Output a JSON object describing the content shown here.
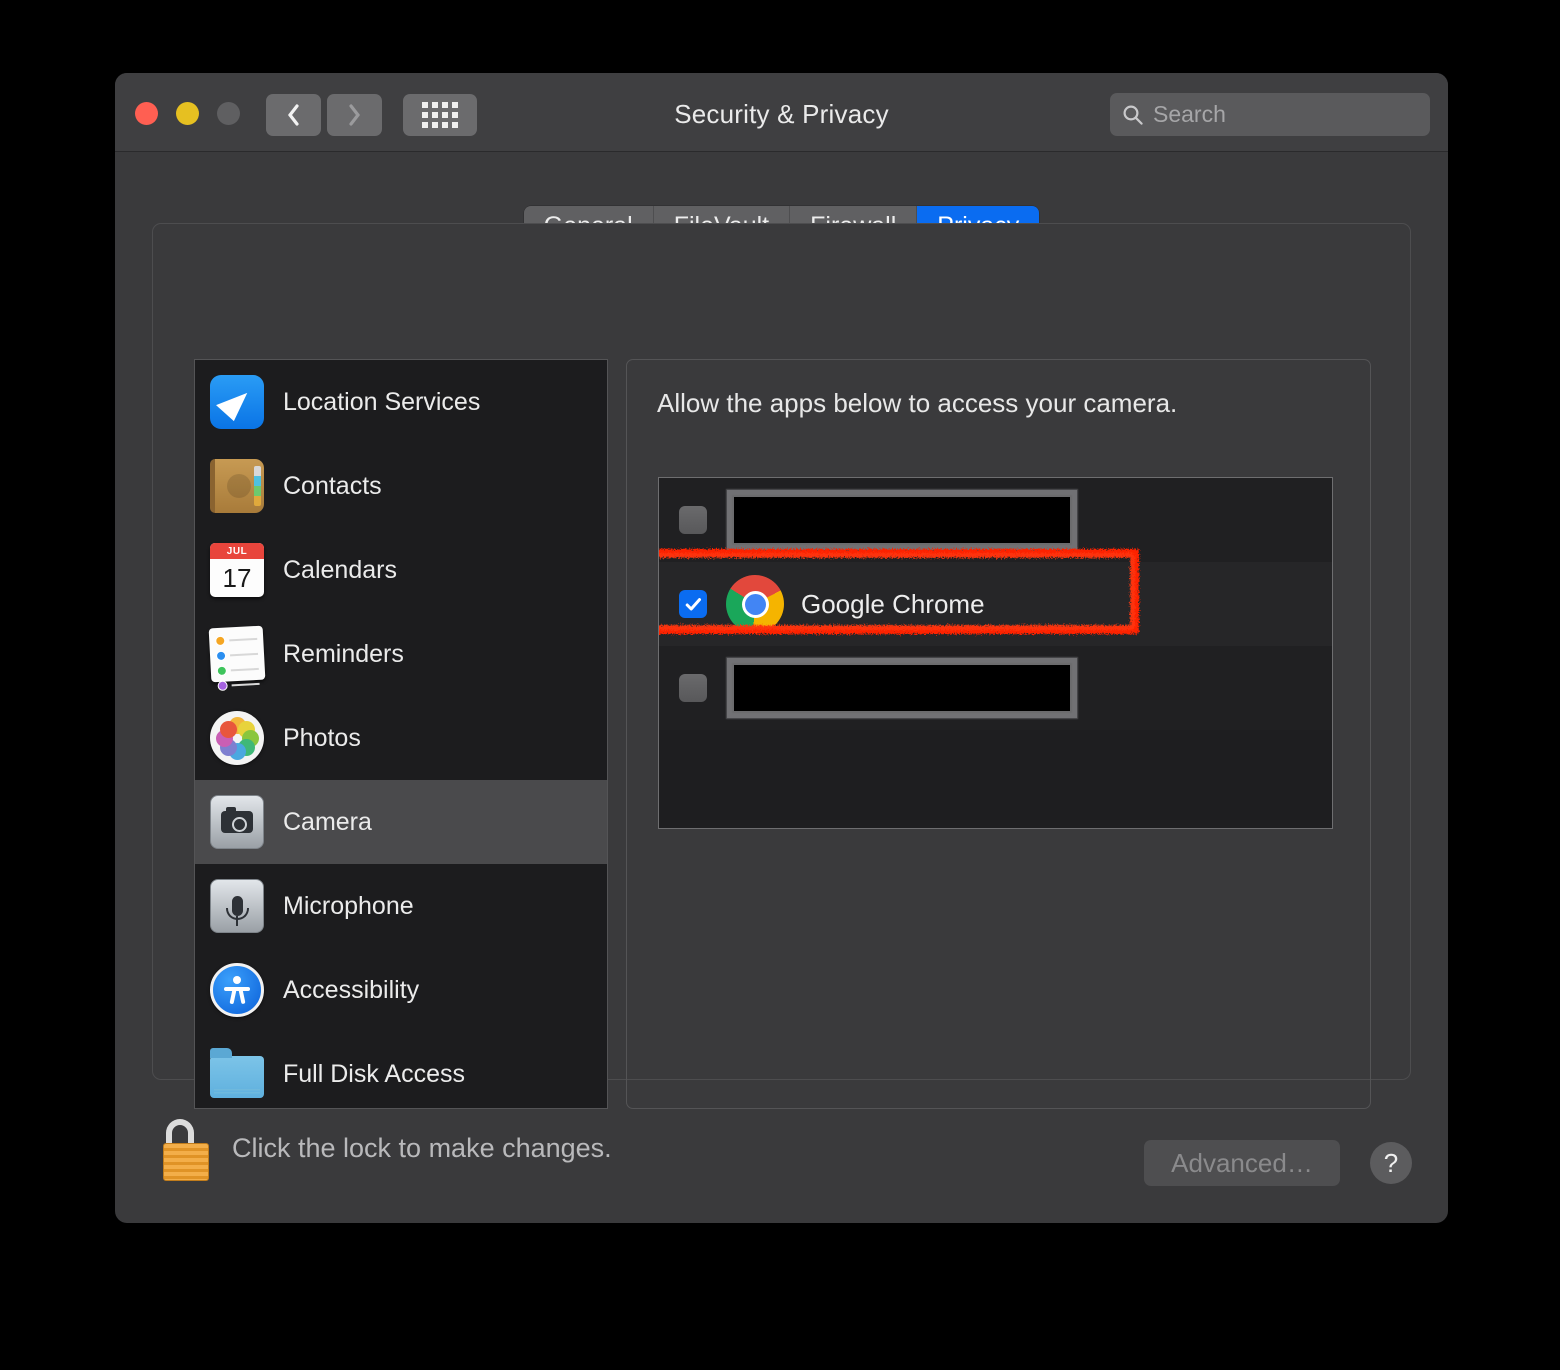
{
  "window": {
    "title": "Security & Privacy",
    "traffic_lights": [
      "close",
      "minimize",
      "zoom"
    ],
    "nav": {
      "back_icon": "chevron-left-icon",
      "forward_icon": "chevron-right-icon",
      "grid_icon": "show-all-grid-icon"
    }
  },
  "search": {
    "placeholder": "Search",
    "value": "",
    "icon": "search-icon"
  },
  "tabs": [
    {
      "label": "General",
      "selected": false
    },
    {
      "label": "FileVault",
      "selected": false
    },
    {
      "label": "Firewall",
      "selected": false
    },
    {
      "label": "Privacy",
      "selected": true
    }
  ],
  "sidebar": {
    "items": [
      {
        "label": "Location Services",
        "icon": "location-services-icon",
        "selected": false
      },
      {
        "label": "Contacts",
        "icon": "contacts-icon",
        "selected": false
      },
      {
        "label": "Calendars",
        "icon": "calendar-icon",
        "selected": false
      },
      {
        "label": "Reminders",
        "icon": "reminders-icon",
        "selected": false
      },
      {
        "label": "Photos",
        "icon": "photos-icon",
        "selected": false
      },
      {
        "label": "Camera",
        "icon": "camera-icon",
        "selected": true
      },
      {
        "label": "Microphone",
        "icon": "microphone-icon",
        "selected": false
      },
      {
        "label": "Accessibility",
        "icon": "accessibility-icon",
        "selected": false
      },
      {
        "label": "Full Disk Access",
        "icon": "folder-icon",
        "selected": false
      }
    ],
    "calendar_icon": {
      "month": "JUL",
      "day": "17"
    }
  },
  "right_pane": {
    "heading": "Allow the apps below to access your camera.",
    "apps": [
      {
        "label": "",
        "redacted": true,
        "checked": false,
        "icon": "redacted-app-icon"
      },
      {
        "label": "Google Chrome",
        "redacted": false,
        "checked": true,
        "icon": "chrome-icon",
        "highlighted": true
      },
      {
        "label": "",
        "redacted": true,
        "checked": false,
        "icon": "redacted-app-icon"
      }
    ]
  },
  "footer": {
    "lock_icon": "lock-open-icon",
    "lock_text": "Click the lock to make changes.",
    "advanced_label": "Advanced…",
    "advanced_disabled": true,
    "help_label": "?"
  },
  "colors": {
    "accent_blue": "#0a6cf1",
    "annotation_red": "#fc2000",
    "window_bg": "#3a3a3c",
    "sidebar_bg": "#1c1c1e",
    "list_bg": "#202022"
  }
}
